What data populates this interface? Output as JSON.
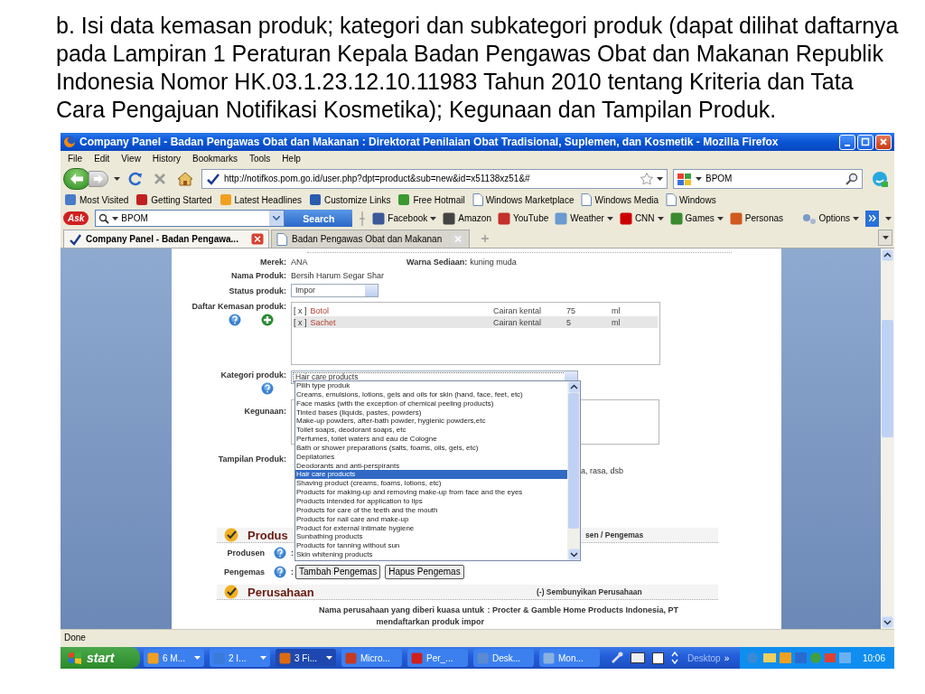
{
  "slide_text": "b. Isi data kemasan produk; kategori dan subkategori produk (dapat dilihat daftarnya pada Lampiran 1 Peraturan Kepala Badan Pengawas Obat dan Makanan Republik Indonesia Nomor HK.03.1.23.12.10.11983 Tahun 2010 tentang Kriteria dan Tata Cara Pengajuan Notifikasi Kosmetika); Kegunaan dan Tampilan Produk.",
  "window": {
    "title": "Company Panel - Badan Pengawas Obat dan Makanan : Direktorat Penilaian Obat Tradisional, Suplemen, dan Kosmetik - Mozilla Firefox"
  },
  "menu": [
    "File",
    "Edit",
    "View",
    "History",
    "Bookmarks",
    "Tools",
    "Help"
  ],
  "address_bar": {
    "url": "http://notifkos.pom.go.id/user.php?dpt=product&sub=new&id=x51138xz51&#"
  },
  "search_bar": {
    "value": "BPOM"
  },
  "bookmarks": [
    {
      "label": "Most Visited",
      "kind": "tile",
      "color": "#4a7bc8"
    },
    {
      "label": "Getting Started",
      "kind": "tile",
      "color": "#c02020"
    },
    {
      "label": "Latest Headlines",
      "kind": "tile",
      "color": "#f0a020"
    },
    {
      "label": "Customize Links",
      "kind": "tile",
      "color": "#2a5cb0"
    },
    {
      "label": "Free Hotmail",
      "kind": "tile",
      "color": "#3a9a30"
    },
    {
      "label": "Windows Marketplace",
      "kind": "page"
    },
    {
      "label": "Windows Media",
      "kind": "page"
    },
    {
      "label": "Windows",
      "kind": "page"
    }
  ],
  "ask_toolbar": {
    "logo": "Ask",
    "search_value": "BPOM",
    "search_button": "Search",
    "options": "Options",
    "items": [
      {
        "label": "Facebook",
        "menu": true,
        "color": "#3b5998"
      },
      {
        "label": "Amazon",
        "menu": false,
        "color": "#444444"
      },
      {
        "label": "YouTube",
        "menu": false,
        "color": "#c4302b"
      },
      {
        "label": "Weather",
        "menu": true,
        "color": "#6a9ad0"
      },
      {
        "label": "CNN",
        "menu": true,
        "color": "#cc0000"
      },
      {
        "label": "Games",
        "menu": true,
        "color": "#3a8a30"
      },
      {
        "label": "Personas",
        "menu": false,
        "color": "#d05a20"
      }
    ]
  },
  "tabs": [
    {
      "label": "Company Panel - Badan Pengawa...",
      "selected": true
    },
    {
      "label": "Badan Pengawas Obat dan Makanan",
      "selected": false
    }
  ],
  "form": {
    "merek": {
      "label": "Merek:",
      "value": "ANA"
    },
    "warna": {
      "label": "Warna Sediaan:",
      "value": "kuning muda"
    },
    "nama": {
      "label": "Nama Produk:",
      "value": "Bersih Harum Segar Shar"
    },
    "status": {
      "label": "Status produk:",
      "value": "Impor"
    },
    "kemasan": {
      "label": "Daftar Kemasan produk:",
      "rows": [
        {
          "remove": "[ x ]",
          "name": "Botol",
          "form": "Cairan kental",
          "amount": "75",
          "unit": "ml",
          "selected": false
        },
        {
          "remove": "[ x ]",
          "name": "Sachet",
          "form": "Cairan kental",
          "amount": "5",
          "unit": "ml",
          "selected": true
        }
      ]
    },
    "kategori": {
      "label": "Kategori produk:",
      "value": "Hair care products",
      "options": [
        {
          "label": "Pilih type produk",
          "selected": false
        },
        {
          "label": "Creams, emulsions, lotions, gels and oils for skin (hand, face, feet, etc)",
          "selected": false
        },
        {
          "label": "Face masks (with the exception of chemical peeling products)",
          "selected": false
        },
        {
          "label": "Tinted bases (liquids, pastes, powders)",
          "selected": false
        },
        {
          "label": "Make-up powders, after-bath powder, hygienic powders,etc",
          "selected": false
        },
        {
          "label": "Toilet soaps, deodorant soaps, etc",
          "selected": false
        },
        {
          "label": "Perfumes, toilet waters and eau de Cologne",
          "selected": false
        },
        {
          "label": "Bath or shower preparations (salts, foams, oils, gels, etc)",
          "selected": false
        },
        {
          "label": "Depilatories",
          "selected": false
        },
        {
          "label": "Deodorants and anti-perspirants",
          "selected": false
        },
        {
          "label": "Hair care products",
          "selected": true
        },
        {
          "label": "Shaving product (creams, foams, lotions, etc)",
          "selected": false
        },
        {
          "label": "Products for making-up and removing make-up from face and the eyes",
          "selected": false
        },
        {
          "label": "Products intended for application to lips",
          "selected": false
        },
        {
          "label": "Products for care of the teeth and the mouth",
          "selected": false
        },
        {
          "label": "Products for nail care and make-up",
          "selected": false
        },
        {
          "label": "Product for external intimate hygiene",
          "selected": false
        },
        {
          "label": "Sunbathing products",
          "selected": false
        },
        {
          "label": "Products for tanning without sun",
          "selected": false
        },
        {
          "label": "Skin whitening products",
          "selected": false
        }
      ]
    },
    "kegunaan": {
      "label": "Kegunaan:"
    },
    "tampilan": {
      "label": "Tampilan Produk:",
      "value": "a, rasa, dsb"
    },
    "produsen_section": {
      "title": "Produs",
      "link": "sen / Pengemas"
    },
    "produsen": {
      "label": "Produsen",
      "separator": ":"
    },
    "pengemas": {
      "label": "Pengemas",
      "separator": ":",
      "buttons": [
        "Tambah Pengemas",
        "Hapus Pengemas"
      ]
    },
    "perusahaan_section": {
      "title": "Perusahaan",
      "link": "(-) Sembunyikan Perusahaan"
    },
    "perusahaan": {
      "label": [
        "Nama perusahaan yang diberi kuasa untuk",
        "mendaftarkan produk impor"
      ],
      "separator": ":",
      "value": "Procter & Gamble Home Products Indonesia, PT"
    }
  },
  "status_bar": "Done",
  "taskbar": {
    "start": "start",
    "items": [
      {
        "label": "6 M...",
        "menu": true,
        "selected": false,
        "color": "#f0a020"
      },
      {
        "label": "2 I...",
        "menu": true,
        "selected": false,
        "color": "#3a7ad8"
      },
      {
        "label": "3 Fi...",
        "menu": true,
        "selected": true,
        "color": "#e06a10"
      },
      {
        "label": "Micro...",
        "menu": false,
        "selected": false,
        "color": "#c83a20"
      },
      {
        "label": "Per_...",
        "menu": false,
        "selected": false,
        "color": "#d02020"
      },
      {
        "label": "Desk...",
        "menu": false,
        "selected": false,
        "color": "#5a8ad0"
      },
      {
        "label": "Mon...",
        "menu": false,
        "selected": false,
        "color": "#8ab0e0"
      }
    ],
    "desktop": "Desktop",
    "more": "»",
    "clock": "10:06"
  }
}
